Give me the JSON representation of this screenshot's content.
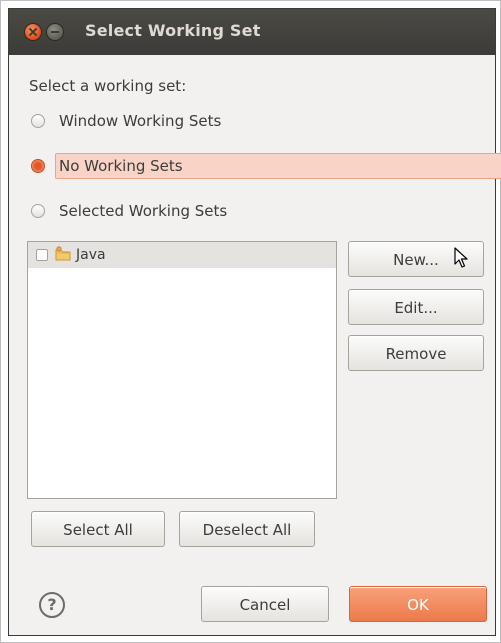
{
  "dialog": {
    "title": "Select Working Set",
    "prompt": "Select a working set:",
    "radio_options": [
      {
        "label": "Window Working Sets",
        "checked": false
      },
      {
        "label": "No Working Sets",
        "checked": true
      },
      {
        "label": "Selected Working Sets",
        "checked": false
      }
    ],
    "working_sets": [
      {
        "label": "Java",
        "checked": false
      }
    ],
    "side_buttons": {
      "new": "New...",
      "edit": "Edit...",
      "remove": "Remove"
    },
    "list_buttons": {
      "select_all": "Select All",
      "deselect_all": "Deselect All"
    },
    "footer": {
      "help_glyph": "?",
      "cancel": "Cancel",
      "ok": "OK"
    }
  },
  "colors": {
    "titlebar": "#3c3b37",
    "accent": "#e9683a",
    "selection_highlight": "#f9d4c6",
    "background": "#f2f1f0"
  },
  "icons": [
    "close-icon",
    "minimize-icon",
    "folder-icon",
    "help-icon",
    "mouse-pointer-icon"
  ]
}
